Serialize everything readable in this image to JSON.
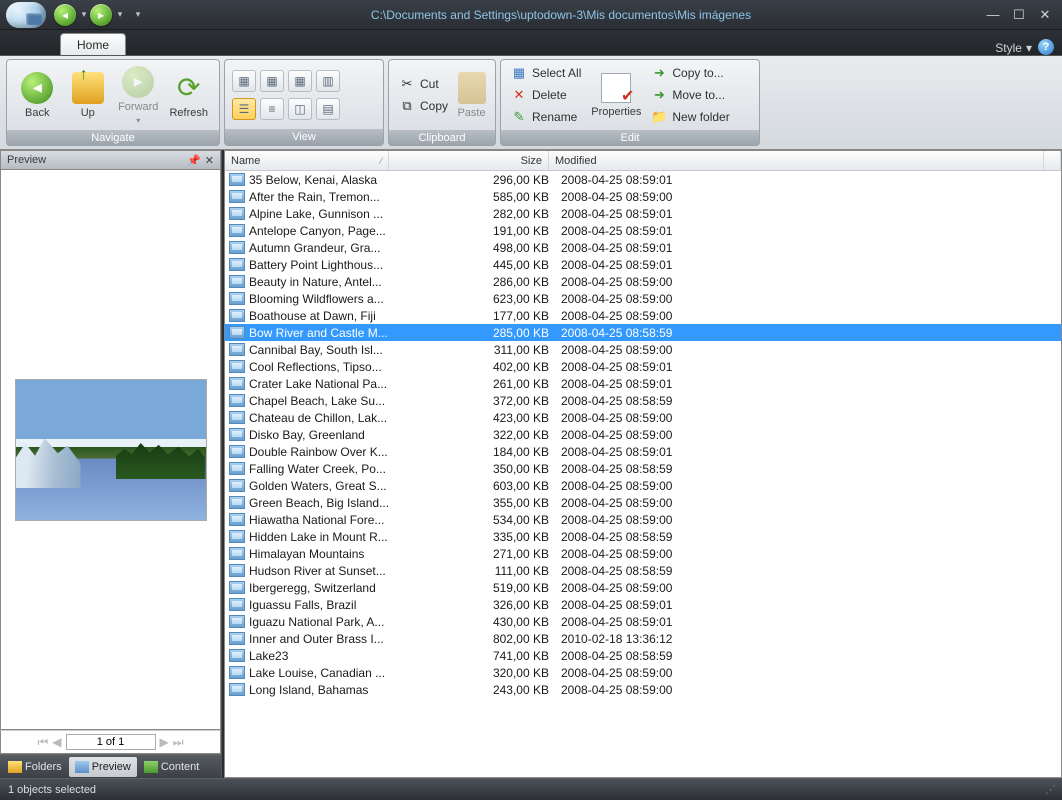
{
  "titlebar": {
    "path": "C:\\Documents and Settings\\uptodown-3\\Mis documentos\\Mis imágenes"
  },
  "tabs": {
    "home": "Home",
    "style": "Style"
  },
  "ribbon": {
    "navigate": {
      "label": "Navigate",
      "back": "Back",
      "up": "Up",
      "forward": "Forward",
      "refresh": "Refresh"
    },
    "view": {
      "label": "View"
    },
    "clipboard": {
      "label": "Clipboard",
      "cut": "Cut",
      "copy": "Copy",
      "paste": "Paste"
    },
    "edit": {
      "label": "Edit",
      "select_all": "Select All",
      "delete": "Delete",
      "rename": "Rename",
      "properties": "Properties",
      "copy_to": "Copy to...",
      "move_to": "Move to...",
      "new_folder": "New folder"
    }
  },
  "preview_panel": {
    "title": "Preview",
    "pager_text": "1 of 1"
  },
  "bottom_tabs": {
    "folders": "Folders",
    "preview": "Preview",
    "content": "Content"
  },
  "columns": {
    "name": "Name",
    "size": "Size",
    "modified": "Modified"
  },
  "statusbar": {
    "text": "1 objects selected"
  },
  "selected_index": 9,
  "files": [
    {
      "name": "35 Below, Kenai, Alaska",
      "size": "296,00 KB",
      "modified": "2008-04-25 08:59:01"
    },
    {
      "name": "After the Rain, Tremon...",
      "size": "585,00 KB",
      "modified": "2008-04-25 08:59:00"
    },
    {
      "name": "Alpine Lake, Gunnison ...",
      "size": "282,00 KB",
      "modified": "2008-04-25 08:59:01"
    },
    {
      "name": "Antelope Canyon, Page...",
      "size": "191,00 KB",
      "modified": "2008-04-25 08:59:01"
    },
    {
      "name": "Autumn Grandeur, Gra...",
      "size": "498,00 KB",
      "modified": "2008-04-25 08:59:01"
    },
    {
      "name": "Battery Point Lighthous...",
      "size": "445,00 KB",
      "modified": "2008-04-25 08:59:01"
    },
    {
      "name": "Beauty in Nature, Antel...",
      "size": "286,00 KB",
      "modified": "2008-04-25 08:59:00"
    },
    {
      "name": "Blooming Wildflowers a...",
      "size": "623,00 KB",
      "modified": "2008-04-25 08:59:00"
    },
    {
      "name": "Boathouse at Dawn, Fiji",
      "size": "177,00 KB",
      "modified": "2008-04-25 08:59:00"
    },
    {
      "name": "Bow River and Castle M...",
      "size": "285,00 KB",
      "modified": "2008-04-25 08:58:59"
    },
    {
      "name": "Cannibal Bay, South Isl...",
      "size": "311,00 KB",
      "modified": "2008-04-25 08:59:00"
    },
    {
      "name": "Cool Reflections, Tipso...",
      "size": "402,00 KB",
      "modified": "2008-04-25 08:59:01"
    },
    {
      "name": "Crater Lake National Pa...",
      "size": "261,00 KB",
      "modified": "2008-04-25 08:59:01"
    },
    {
      "name": "Chapel Beach, Lake Su...",
      "size": "372,00 KB",
      "modified": "2008-04-25 08:58:59"
    },
    {
      "name": "Chateau de Chillon, Lak...",
      "size": "423,00 KB",
      "modified": "2008-04-25 08:59:00"
    },
    {
      "name": "Disko Bay, Greenland",
      "size": "322,00 KB",
      "modified": "2008-04-25 08:59:00"
    },
    {
      "name": "Double Rainbow Over K...",
      "size": "184,00 KB",
      "modified": "2008-04-25 08:59:01"
    },
    {
      "name": "Falling Water Creek, Po...",
      "size": "350,00 KB",
      "modified": "2008-04-25 08:58:59"
    },
    {
      "name": "Golden Waters, Great S...",
      "size": "603,00 KB",
      "modified": "2008-04-25 08:59:00"
    },
    {
      "name": "Green Beach, Big Island...",
      "size": "355,00 KB",
      "modified": "2008-04-25 08:59:00"
    },
    {
      "name": "Hiawatha National Fore...",
      "size": "534,00 KB",
      "modified": "2008-04-25 08:59:00"
    },
    {
      "name": "Hidden Lake in Mount R...",
      "size": "335,00 KB",
      "modified": "2008-04-25 08:58:59"
    },
    {
      "name": "Himalayan Mountains",
      "size": "271,00 KB",
      "modified": "2008-04-25 08:59:00"
    },
    {
      "name": "Hudson River at Sunset...",
      "size": "111,00 KB",
      "modified": "2008-04-25 08:58:59"
    },
    {
      "name": "Ibergeregg, Switzerland",
      "size": "519,00 KB",
      "modified": "2008-04-25 08:59:00"
    },
    {
      "name": "Iguassu Falls, Brazil",
      "size": "326,00 KB",
      "modified": "2008-04-25 08:59:01"
    },
    {
      "name": "Iguazu National Park, A...",
      "size": "430,00 KB",
      "modified": "2008-04-25 08:59:01"
    },
    {
      "name": "Inner and Outer Brass I...",
      "size": "802,00 KB",
      "modified": "2010-02-18 13:36:12"
    },
    {
      "name": "Lake23",
      "size": "741,00 KB",
      "modified": "2008-04-25 08:58:59"
    },
    {
      "name": "Lake Louise, Canadian ...",
      "size": "320,00 KB",
      "modified": "2008-04-25 08:59:00"
    },
    {
      "name": "Long Island, Bahamas",
      "size": "243,00 KB",
      "modified": "2008-04-25 08:59:00"
    }
  ]
}
